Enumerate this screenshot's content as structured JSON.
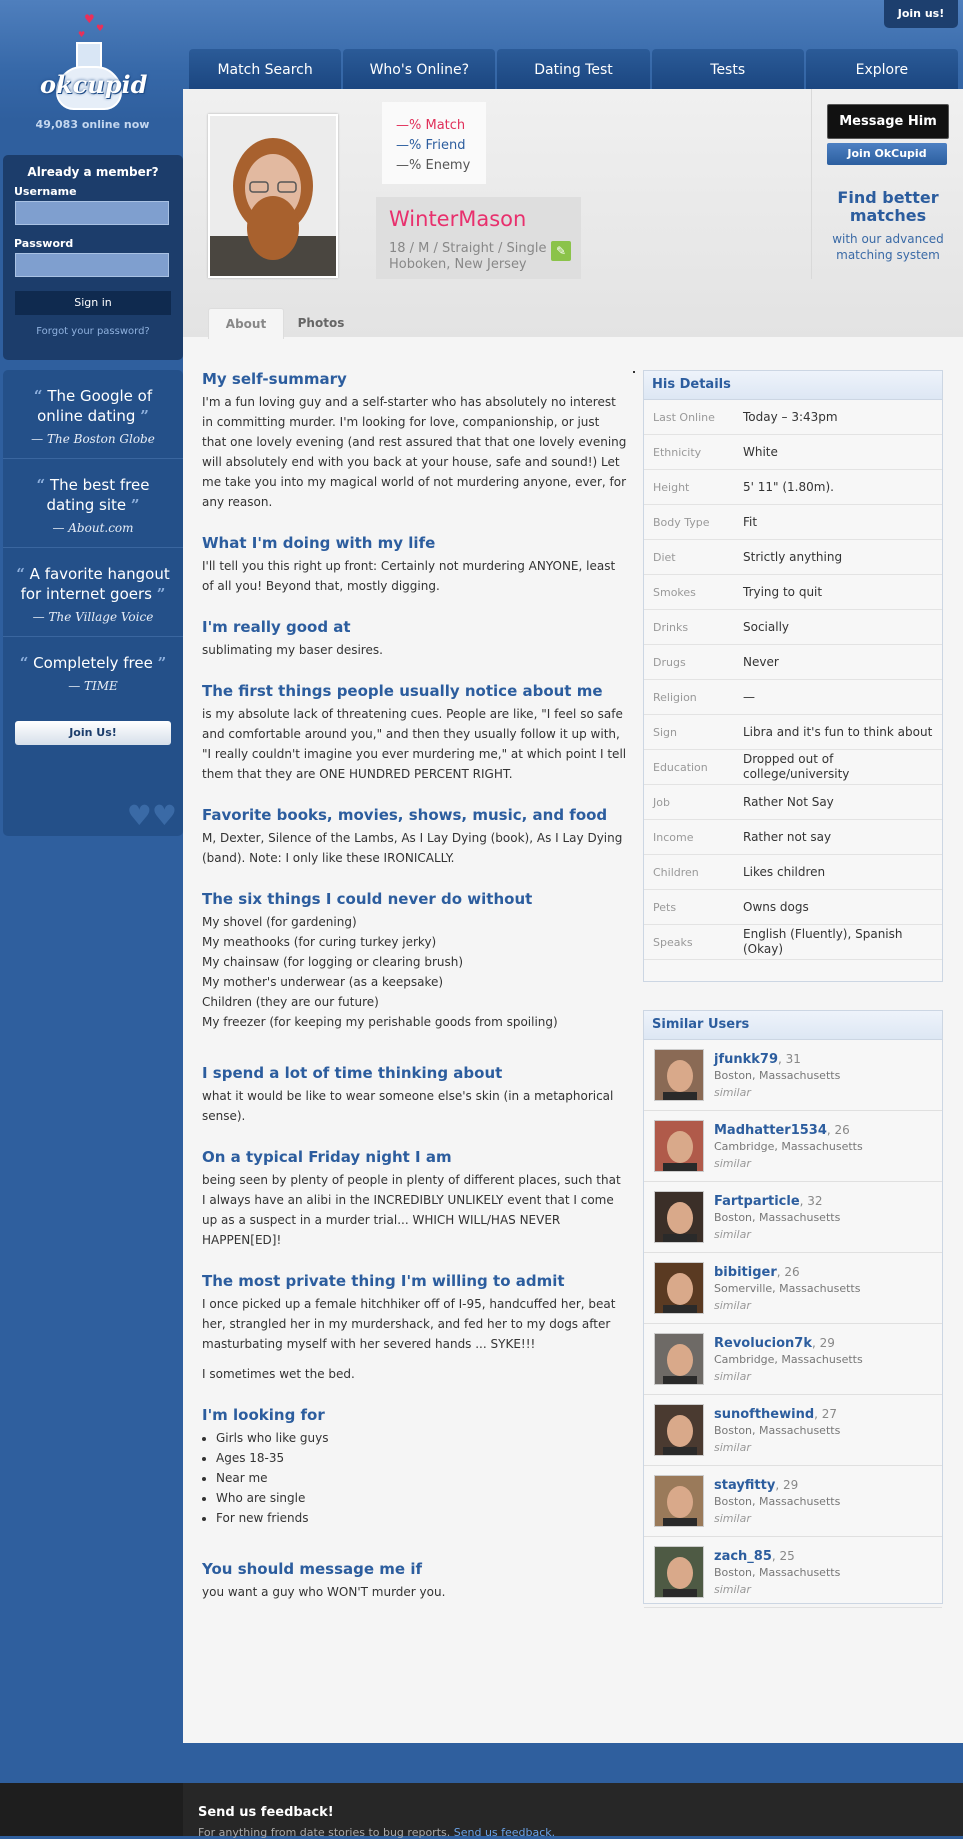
{
  "header": {
    "join_top": "Join us!",
    "online_now": "49,083 online now"
  },
  "logo": {
    "word": "okcupid"
  },
  "login": {
    "title": "Already a member?",
    "username_label": "Username",
    "password_label": "Password",
    "signin_label": "Sign in",
    "forgot": "Forgot your password?"
  },
  "quotes": [
    {
      "text": "The Google of online dating",
      "source": "— The Boston Globe"
    },
    {
      "text": "The best free dating site",
      "source": "— About.com"
    },
    {
      "text": "A favorite hangout for internet goers",
      "source": "— The Village Voice"
    },
    {
      "text": "Completely free",
      "source": "— TIME"
    }
  ],
  "join_button": "Join Us!",
  "nav": [
    "Match Search",
    "Who's Online?",
    "Dating Test",
    "Tests",
    "Explore"
  ],
  "profile": {
    "match": "—% Match",
    "friend": "—% Friend",
    "enemy": "—% Enemy",
    "username": "WinterMason",
    "meta1": "18 / M / Straight / Single",
    "meta2": "Hoboken, New Jersey"
  },
  "actions": {
    "message": "Message Him",
    "join": "Join OkCupid",
    "find_title": "Find better matches",
    "find_sub": "with our advanced matching system"
  },
  "tabs": [
    "About",
    "Photos"
  ],
  "essays": [
    {
      "title": "My self-summary",
      "body": [
        "I'm a fun loving guy and a self-starter who has absolutely no interest in committing murder. I'm looking for love, companionship, or just that one lovely evening (and rest assured that that one lovely evening will absolutely end with you back at your house, safe and sound!) Let me take you into my magical world of not murdering anyone, ever, for any reason."
      ]
    },
    {
      "title": "What I'm doing with my life",
      "body": [
        "I'll tell you this right up front: Certainly not murdering ANYONE, least of all you! Beyond that, mostly digging."
      ]
    },
    {
      "title": "I'm really good at",
      "body": [
        "sublimating my baser desires."
      ]
    },
    {
      "title": "The first things people usually notice about me",
      "body": [
        "is my absolute lack of threatening cues. People are like, \"I feel so safe and comfortable around you,\" and then they usually follow it up with, \"I really couldn't imagine you ever murdering me,\" at which point I tell them that they are ONE HUNDRED PERCENT RIGHT."
      ]
    },
    {
      "title": "Favorite books, movies, shows, music, and food",
      "body": [
        "M, Dexter, Silence of the Lambs, As I Lay Dying (book), As I Lay Dying (band). Note: I only like these IRONICALLY."
      ]
    },
    {
      "title": "I spend a lot of time thinking about",
      "body": [
        "what it would be like to wear someone else's skin (in a metaphorical sense)."
      ]
    },
    {
      "title": "On a typical Friday night I am",
      "body": [
        "being seen by plenty of people in plenty of different places, such that I always have an alibi in the INCREDIBLY UNLIKELY event that I come up as a suspect in a murder trial... WHICH WILL/HAS NEVER HAPPEN[ED]!"
      ]
    },
    {
      "title": "The most private thing I'm willing to admit",
      "body": [
        "I once picked up a female hitchhiker off of I-95, handcuffed her, beat her, strangled her in my murdershack, and fed her to my dogs after masturbating myself with her severed hands ... SYKE!!!",
        "I sometimes wet the bed."
      ]
    },
    {
      "title": "You should message me if",
      "body": [
        "you want a guy who WON'T murder you."
      ]
    }
  ],
  "six_things": {
    "title": "The six things I could never do without",
    "items": [
      "My shovel (for gardening)",
      "My meathooks (for curing turkey jerky)",
      "My chainsaw (for logging or clearing brush)",
      "My mother's underwear (as a keepsake)",
      "Children (they are our future)",
      "My freezer (for keeping my perishable goods from spoiling)"
    ]
  },
  "looking_for": {
    "title": "I'm looking for",
    "items": [
      "Girls who like guys",
      "Ages 18-35",
      "Near me",
      "Who are single",
      "For new friends"
    ]
  },
  "details": {
    "title": "His Details",
    "rows": [
      {
        "k": "Last Online",
        "v": "Today – 3:43pm"
      },
      {
        "k": "Ethnicity",
        "v": "White"
      },
      {
        "k": "Height",
        "v": "5' 11\" (1.80m)."
      },
      {
        "k": "Body Type",
        "v": "Fit"
      },
      {
        "k": "Diet",
        "v": "Strictly anything"
      },
      {
        "k": "Smokes",
        "v": "Trying to quit"
      },
      {
        "k": "Drinks",
        "v": "Socially"
      },
      {
        "k": "Drugs",
        "v": "Never"
      },
      {
        "k": "Religion",
        "v": "—"
      },
      {
        "k": "Sign",
        "v": "Libra and it's fun to think about"
      },
      {
        "k": "Education",
        "v": "Dropped out of college/university"
      },
      {
        "k": "Job",
        "v": "Rather Not Say"
      },
      {
        "k": "Income",
        "v": "Rather not say"
      },
      {
        "k": "Children",
        "v": "Likes children"
      },
      {
        "k": "Pets",
        "v": "Owns dogs"
      },
      {
        "k": "Speaks",
        "v": "English (Fluently), Spanish (Okay)"
      }
    ]
  },
  "similar": {
    "title": "Similar Users",
    "users": [
      {
        "name": "jfunkk79",
        "age": ", 31",
        "loc": "Boston, Massachusetts",
        "sim": "similar",
        "color": "#8a6a55"
      },
      {
        "name": "Madhatter1534",
        "age": ", 26",
        "loc": "Cambridge, Massachusetts",
        "sim": "similar",
        "color": "#b05a4a"
      },
      {
        "name": "Fartparticle",
        "age": ", 32",
        "loc": "Boston, Massachusetts",
        "sim": "similar",
        "color": "#3b2f28"
      },
      {
        "name": "bibitiger",
        "age": ", 26",
        "loc": "Somerville, Massachusetts",
        "sim": "similar",
        "color": "#5a3a22"
      },
      {
        "name": "Revolucion7k",
        "age": ", 29",
        "loc": "Cambridge, Massachusetts",
        "sim": "similar",
        "color": "#6e6a66"
      },
      {
        "name": "sunofthewind",
        "age": ", 27",
        "loc": "Boston, Massachusetts",
        "sim": "similar",
        "color": "#4a3a30"
      },
      {
        "name": "stayfitty",
        "age": ", 29",
        "loc": "Boston, Massachusetts",
        "sim": "similar",
        "color": "#9a7a5a"
      },
      {
        "name": "zach_85",
        "age": ", 25",
        "loc": "Boston, Massachusetts",
        "sim": "similar",
        "color": "#4e5a44"
      }
    ]
  },
  "footer": {
    "title": "Send us feedback!",
    "text": "For anything from date stories to bug reports.",
    "link": "Send us feedback."
  }
}
